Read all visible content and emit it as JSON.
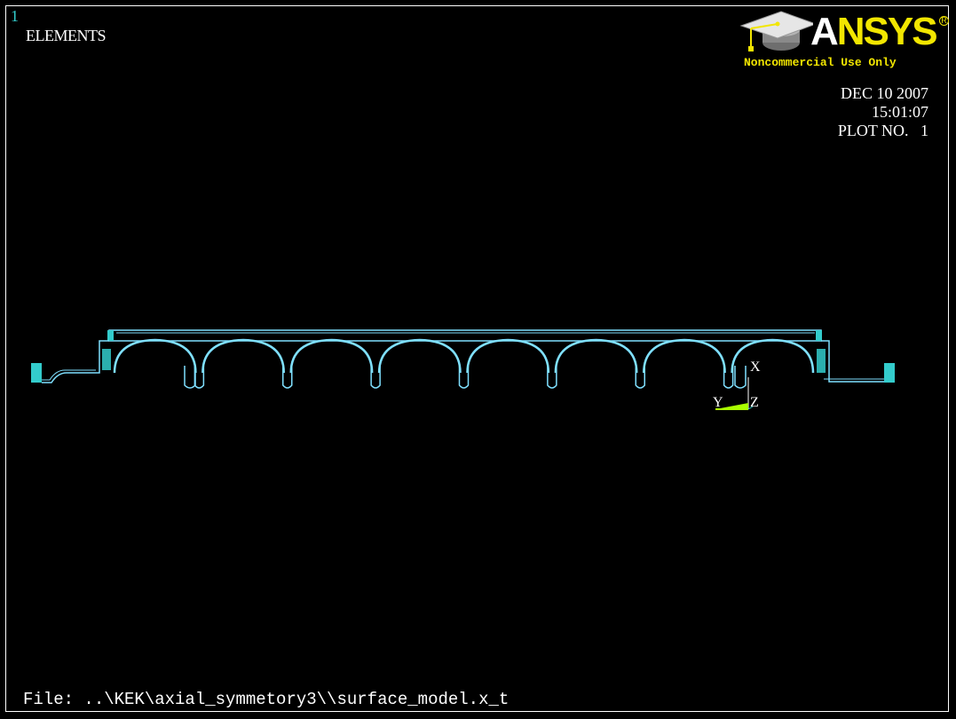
{
  "window_number": "1",
  "plot_title": "ELEMENTS",
  "logo": {
    "brand": "ANSYS",
    "brand_first": "A",
    "brand_rest": "NSYS",
    "registered_mark": "R",
    "license_text": "Noncommercial Use Only",
    "icon": "graduation-cap-icon"
  },
  "stamp": {
    "date": "DEC 10 2007",
    "time": "15:01:07",
    "plot_no": "PLOT NO.   1"
  },
  "triad": {
    "x_label": "X",
    "y_label": "Y",
    "z_label": "Z"
  },
  "model": {
    "cell_count": 8,
    "line_color": "#7fe0ff",
    "fill_color": "#33cccc"
  },
  "file_line": "File: ..\\KEK\\axial_symmetory3\\\\surface_model.x_t",
  "colors": {
    "background": "#000000",
    "text": "#ffffff",
    "accent_cyan": "#33cccc",
    "logo_yellow": "#f2e600",
    "triad_green": "#aaff00"
  }
}
